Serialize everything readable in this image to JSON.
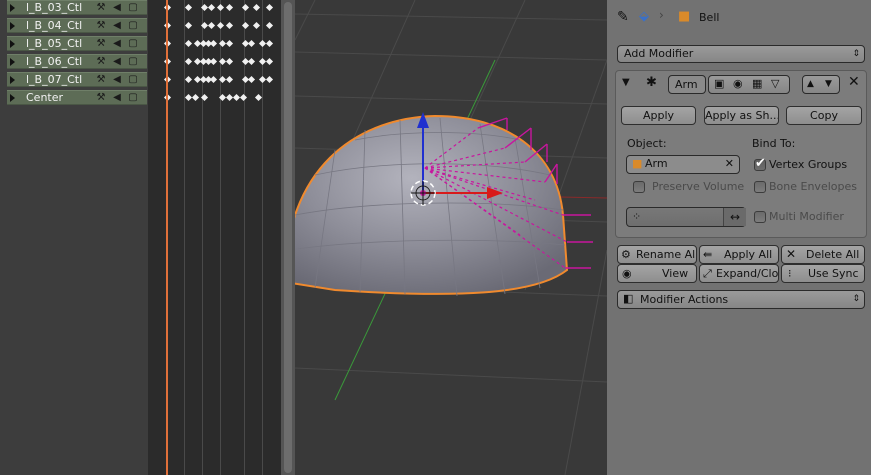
{
  "channels": [
    {
      "name": "l_B_03_Ctl"
    },
    {
      "name": "l_B_04_Ctl"
    },
    {
      "name": "l_B_05_Ctl"
    },
    {
      "name": "l_B_06_Ctl"
    },
    {
      "name": "l_B_07_Ctl"
    },
    {
      "name": "Center"
    }
  ],
  "channel_icons": [
    "wrench-icon",
    "speaker-icon",
    "lock-icon"
  ],
  "properties": {
    "object_name": "Bell",
    "add_modifier_label": "Add Modifier",
    "modifier": {
      "name": "Arm",
      "apply_label": "Apply",
      "apply_shape_label": "Apply as Sh...",
      "copy_label": "Copy",
      "object_label": "Object:",
      "object_value": "Arm",
      "bind_to_label": "Bind To:",
      "vertex_groups_label": "Vertex Groups",
      "vertex_groups_checked": true,
      "preserve_volume_label": "Preserve Volume",
      "preserve_volume_checked": false,
      "bone_envelopes_label": "Bone Envelopes",
      "bone_envelopes_checked": false,
      "multi_modifier_label": "Multi Modifier",
      "multi_modifier_checked": false
    },
    "tools": {
      "rename_all_label": "Rename All",
      "apply_all_label": "Apply All",
      "delete_all_label": "Delete All",
      "view_label": "View",
      "expand_collapse_label": "Expand/Clo...",
      "use_sync_label": "Use Sync"
    },
    "modifier_actions_label": "Modifier Actions"
  },
  "colors": {
    "channel_bg": "#5d6c56",
    "playhead": "#e0703a",
    "selection_outline": "#f08a2e",
    "bone_magenta": "#c8169e",
    "axis_red": "#d81a1a",
    "axis_blue": "#2030d0",
    "axis_green": "#3a9a3a",
    "props_bg": "#727272"
  }
}
